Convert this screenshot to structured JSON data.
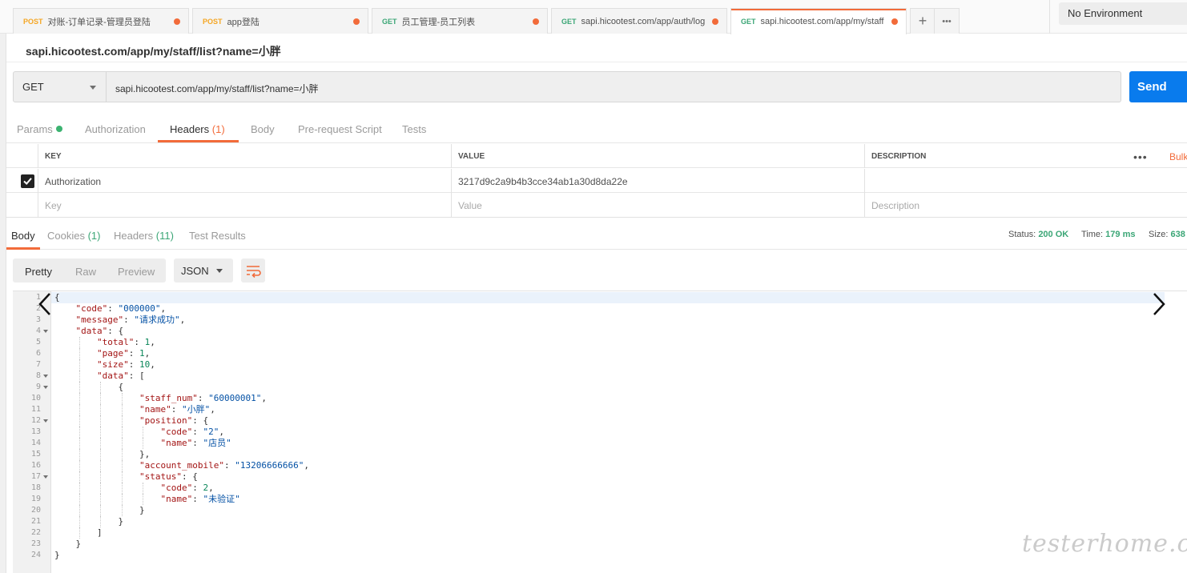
{
  "tabs": [
    {
      "method": "POST",
      "title": "对账-订单记录-管理员登陆"
    },
    {
      "method": "POST",
      "title": "app登陆"
    },
    {
      "method": "GET",
      "title": "员工管理-员工列表"
    },
    {
      "method": "GET",
      "title": "sapi.hicootest.com/app/auth/log"
    },
    {
      "method": "GET",
      "title": "sapi.hicootest.com/app/my/staff"
    }
  ],
  "tab_actions": {
    "add": "+",
    "more": "•••"
  },
  "environment": "No Environment",
  "request_title": "sapi.hicootest.com/app/my/staff/list?name=小胖",
  "request": {
    "method": "GET",
    "url": "sapi.hicootest.com/app/my/staff/list?name=小胖",
    "send": "Send"
  },
  "request_tabs": {
    "params": "Params",
    "authorization": "Authorization",
    "headers": "Headers",
    "headers_count": "(1)",
    "body": "Body",
    "prerequest": "Pre-request Script",
    "tests": "Tests"
  },
  "headers_table": {
    "columns": {
      "key": "KEY",
      "value": "VALUE",
      "description": "DESCRIPTION"
    },
    "more": "•••",
    "bulk_edit": "Bulk",
    "row": {
      "key": "Authorization",
      "value": "3217d9c2a9b4b3cce34ab1a30d8da22e",
      "description": ""
    },
    "placeholders": {
      "key": "Key",
      "value": "Value",
      "description": "Description"
    }
  },
  "response_tabs": {
    "body": "Body",
    "cookies": "Cookies",
    "cookies_count": "(1)",
    "headers": "Headers",
    "headers_count": "(11)",
    "test_results": "Test Results"
  },
  "response_meta": {
    "status_label": "Status:",
    "status_value": "200 OK",
    "time_label": "Time:",
    "time_value": "179 ms",
    "size_label": "Size:",
    "size_value": "638"
  },
  "response_view": {
    "pretty": "Pretty",
    "raw": "Raw",
    "preview": "Preview",
    "format": "JSON"
  },
  "code_lines": [
    {
      "n": "1",
      "fold": false,
      "indent": 0,
      "html": "<span class=\"ch\">{</span>"
    },
    {
      "n": "2",
      "fold": false,
      "indent": 1,
      "html": "<span class=\"k\">\"code\"</span>: <span class=\"s\">\"000000\"</span>,"
    },
    {
      "n": "3",
      "fold": false,
      "indent": 1,
      "html": "<span class=\"k\">\"message\"</span>: <span class=\"s\">\"请求成功\"</span>,"
    },
    {
      "n": "4",
      "fold": true,
      "indent": 1,
      "html": "<span class=\"k\">\"data\"</span>: {"
    },
    {
      "n": "5",
      "fold": false,
      "indent": 2,
      "html": "<span class=\"k\">\"total\"</span>: <span class=\"n\">1</span>,"
    },
    {
      "n": "6",
      "fold": false,
      "indent": 2,
      "html": "<span class=\"k\">\"page\"</span>: <span class=\"n\">1</span>,"
    },
    {
      "n": "7",
      "fold": false,
      "indent": 2,
      "html": "<span class=\"k\">\"size\"</span>: <span class=\"n\">10</span>,"
    },
    {
      "n": "8",
      "fold": true,
      "indent": 2,
      "html": "<span class=\"k\">\"data\"</span>: ["
    },
    {
      "n": "9",
      "fold": true,
      "indent": 3,
      "html": "{"
    },
    {
      "n": "10",
      "fold": false,
      "indent": 4,
      "html": "<span class=\"k\">\"staff_num\"</span>: <span class=\"s\">\"60000001\"</span>,"
    },
    {
      "n": "11",
      "fold": false,
      "indent": 4,
      "html": "<span class=\"k\">\"name\"</span>: <span class=\"s\">\"小胖\"</span>,"
    },
    {
      "n": "12",
      "fold": true,
      "indent": 4,
      "html": "<span class=\"k\">\"position\"</span>: {"
    },
    {
      "n": "13",
      "fold": false,
      "indent": 5,
      "html": "<span class=\"k\">\"code\"</span>: <span class=\"s\">\"2\"</span>,"
    },
    {
      "n": "14",
      "fold": false,
      "indent": 5,
      "html": "<span class=\"k\">\"name\"</span>: <span class=\"s\">\"店员\"</span>"
    },
    {
      "n": "15",
      "fold": false,
      "indent": 4,
      "html": "},"
    },
    {
      "n": "16",
      "fold": false,
      "indent": 4,
      "html": "<span class=\"k\">\"account_mobile\"</span>: <span class=\"s\">\"13206666666\"</span>,"
    },
    {
      "n": "17",
      "fold": true,
      "indent": 4,
      "html": "<span class=\"k\">\"status\"</span>: {"
    },
    {
      "n": "18",
      "fold": false,
      "indent": 5,
      "html": "<span class=\"k\">\"code\"</span>: <span class=\"n\">2</span>,"
    },
    {
      "n": "19",
      "fold": false,
      "indent": 5,
      "html": "<span class=\"k\">\"name\"</span>: <span class=\"s\">\"未验证\"</span>"
    },
    {
      "n": "20",
      "fold": false,
      "indent": 4,
      "html": "}"
    },
    {
      "n": "21",
      "fold": false,
      "indent": 3,
      "html": "}"
    },
    {
      "n": "22",
      "fold": false,
      "indent": 2,
      "html": "]"
    },
    {
      "n": "23",
      "fold": false,
      "indent": 1,
      "html": "}"
    },
    {
      "n": "24",
      "fold": false,
      "indent": 0,
      "html": "}"
    }
  ],
  "watermark": "testerhome.com",
  "colors": {
    "accent": "#f26b3a",
    "send": "#097bed",
    "success": "#3ba676"
  },
  "icons": [
    "plus-icon",
    "more-icon",
    "caret-down-icon",
    "check-icon",
    "wrap-lines-icon",
    "chevron-left-icon",
    "chevron-right-icon"
  ]
}
